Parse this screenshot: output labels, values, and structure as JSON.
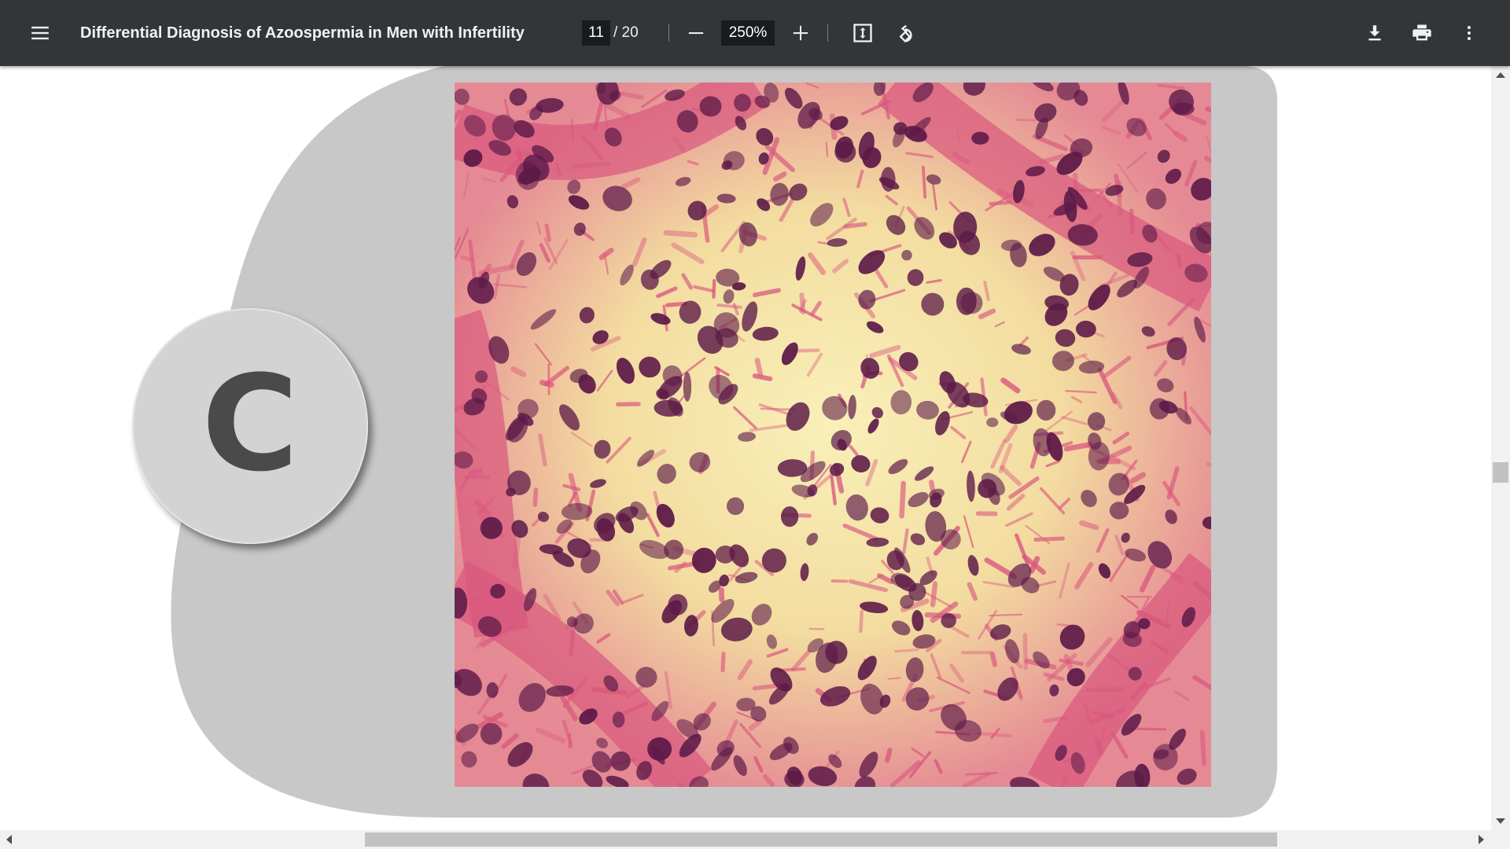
{
  "toolbar": {
    "title": "Differential Diagnosis of Azoospermia in Men with Infertility",
    "current_page": "11",
    "page_separator": "/ 20",
    "zoom": "250%",
    "icons": {
      "menu": "menu-icon",
      "zoom_out": "minus-icon",
      "zoom_in": "plus-icon",
      "fit": "fit-to-page-icon",
      "rotate": "rotate-icon",
      "download": "download-icon",
      "print": "print-icon",
      "more": "more-vertical-icon"
    }
  },
  "document": {
    "badge_letter": "C"
  },
  "colors": {
    "toolbar_bg": "#323639",
    "slide_gray": "#c8c8c8",
    "badge_fill": "#d3d3d3",
    "tissue_pink": "#d9577e",
    "nuclei_purple": "#5d1a48",
    "lumen_yellow": "#f6eaa8"
  }
}
